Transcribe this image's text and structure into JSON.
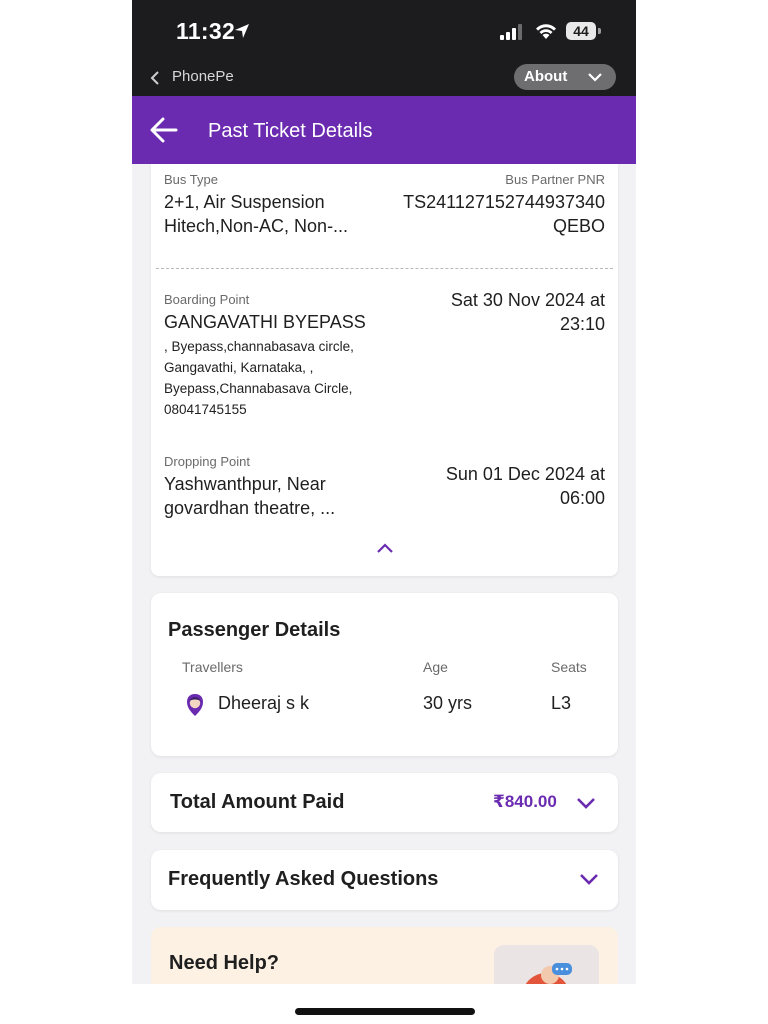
{
  "status_bar": {
    "time": "11:32",
    "battery": "44"
  },
  "app_strip": {
    "title": "PhonePe",
    "about_label": "About"
  },
  "header": {
    "title": "Past Ticket Details"
  },
  "trip": {
    "bus_type_label": "Bus Type",
    "bus_type_value": "2+1, Air Suspension Hitech,Non-AC, Non-...",
    "pnr_label": "Bus Partner PNR",
    "pnr_value": "TS241127152744937340 QEBO",
    "boarding_label": "Boarding Point",
    "boarding_point": "GANGAVATHI BYEPASS",
    "boarding_address": ", Byepass,channabasava circle, Gangavathi, Karnataka, , Byepass,Channabasava Circle, 08041745155",
    "boarding_time": "Sat 30 Nov 2024 at 23:10",
    "dropping_label": "Dropping Point",
    "dropping_point": "Yashwanthpur,  Near govardhan theatre, ...",
    "dropping_time": "Sun 01 Dec 2024 at 06:00"
  },
  "passenger": {
    "title": "Passenger Details",
    "col_travellers": "Travellers",
    "col_age": "Age",
    "col_seats": "Seats",
    "rows": [
      {
        "name": "Dheeraj s k",
        "age": "30 yrs",
        "seat": "L3"
      }
    ]
  },
  "total": {
    "label": "Total Amount Paid",
    "amount": "₹840.00"
  },
  "faq": {
    "label": "Frequently Asked Questions"
  },
  "help": {
    "label": "Need Help?"
  },
  "colors": {
    "brand": "#6a2bb0",
    "status_bar": "#1c1c1e",
    "help_bg": "#fdf1e3"
  }
}
